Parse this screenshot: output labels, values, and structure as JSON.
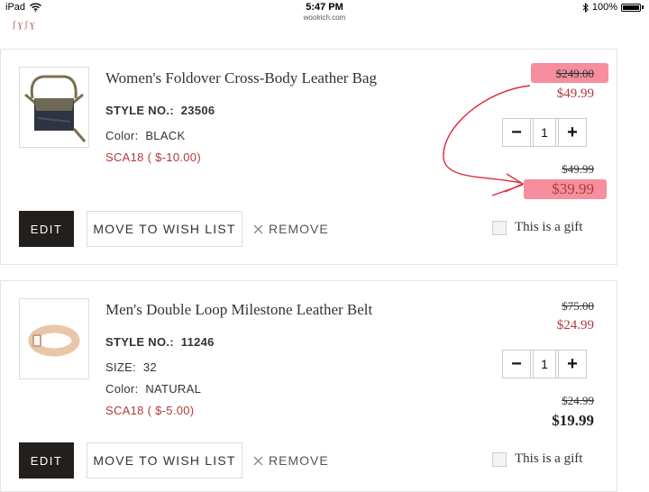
{
  "status_bar": {
    "device": "iPad",
    "time": "5:47 PM",
    "url": "woolrich.com",
    "battery": "100%"
  },
  "items": [
    {
      "name": "Women's Foldover Cross-Body Leather Bag",
      "style_label": "STYLE NO.:",
      "style_no": "23506",
      "color_label": "Color:",
      "color": "BLACK",
      "promo": "SCA18 ( $-10.00)",
      "original_price": "$249.00",
      "sale_price": "$49.99",
      "quantity": "1",
      "subtotal_original": "$49.99",
      "subtotal_final": "$39.99"
    },
    {
      "name": "Men's Double Loop Milestone Leather Belt",
      "style_label": "STYLE NO.:",
      "style_no": "11246",
      "size_label": "SIZE:",
      "size": "32",
      "color_label": "Color:",
      "color": "NATURAL",
      "promo": "SCA18 ( $-5.00)",
      "original_price": "$75.00",
      "sale_price": "$24.99",
      "quantity": "1",
      "subtotal_original": "$24.99",
      "subtotal_final": "$19.99"
    }
  ],
  "actions": {
    "edit": "EDIT",
    "wishlist": "MOVE TO WISH LIST",
    "remove": "REMOVE",
    "gift": "This is a gift",
    "minus": "−",
    "plus": "+"
  },
  "colors": {
    "accent_red": "#b03a3a",
    "edit_bg": "#221f1c",
    "highlight": "#f47a8c",
    "annotation": "#e0283c"
  }
}
